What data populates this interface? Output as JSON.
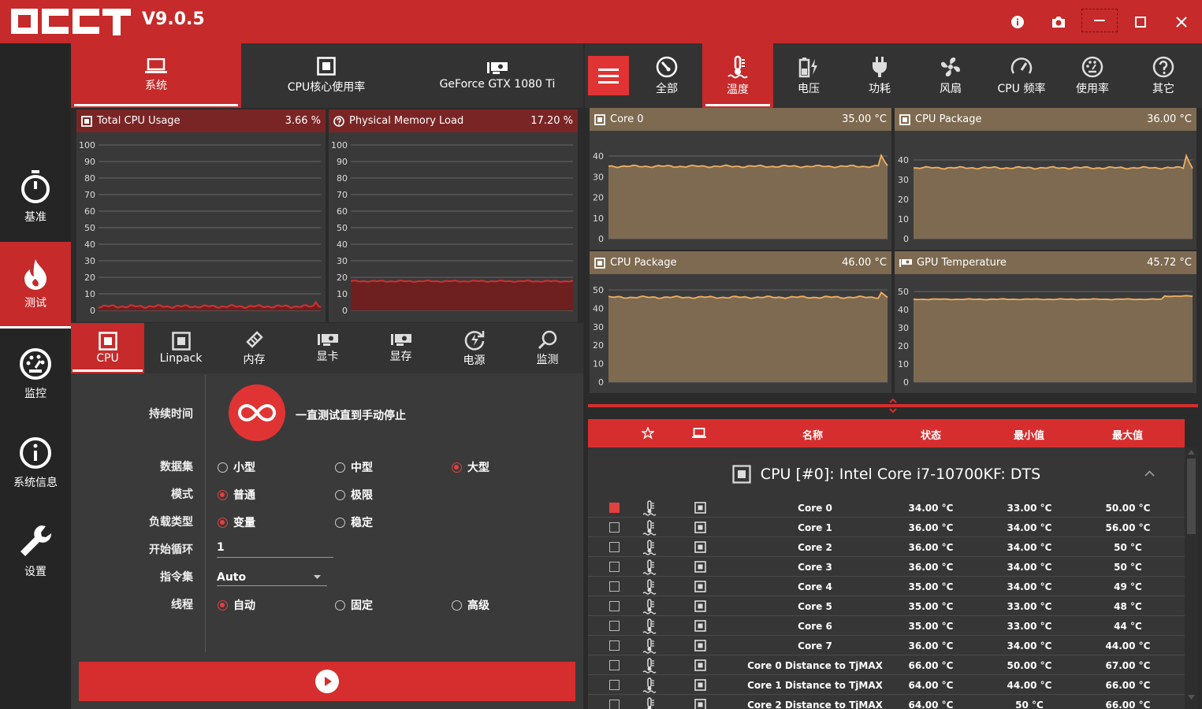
{
  "app": {
    "version": "V9.0.5",
    "accent": "#c62a2a"
  },
  "titlebar": {
    "icons": [
      "info-icon",
      "camera-icon",
      "minimize-icon",
      "maximize-icon",
      "close-icon"
    ]
  },
  "sidebar": {
    "items": [
      {
        "label": "基准",
        "icon": "stopwatch-icon"
      },
      {
        "label": "测试",
        "icon": "flame-icon"
      },
      {
        "label": "监控",
        "icon": "gauge-icon"
      },
      {
        "label": "系统信息",
        "icon": "info-circle-icon"
      },
      {
        "label": "设置",
        "icon": "wrench-icon"
      }
    ]
  },
  "left_tabs": [
    {
      "label": "系统"
    },
    {
      "label": "CPU核心使用率"
    },
    {
      "label": "GeForce GTX 1080 Ti"
    }
  ],
  "graphs": [
    {
      "title": "Total CPU Usage",
      "value": "3.66 %",
      "ticks": [
        "100",
        "90",
        "80",
        "70",
        "60",
        "50",
        "40",
        "30",
        "20",
        "10",
        "0"
      ]
    },
    {
      "title": "Physical Memory Load",
      "value": "17.20 %",
      "ticks": [
        "100",
        "90",
        "80",
        "70",
        "60",
        "50",
        "40",
        "30",
        "20",
        "10",
        "0"
      ]
    }
  ],
  "test_tabs": [
    {
      "label": "CPU"
    },
    {
      "label": "Linpack"
    },
    {
      "label": "内存"
    },
    {
      "label": "显卡"
    },
    {
      "label": "显存"
    },
    {
      "label": "电源"
    },
    {
      "label": "监测"
    }
  ],
  "settings": {
    "duration_label": "持续时间",
    "duration_text": "一直测试直到手动停止",
    "dataset_label": "数据集",
    "dataset_options": [
      "小型",
      "中型",
      "大型"
    ],
    "mode_label": "模式",
    "mode_options": [
      "普通",
      "极限"
    ],
    "load_label": "负载类型",
    "load_options": [
      "变量",
      "稳定"
    ],
    "cycle_label": "开始循环",
    "cycle_value": "1",
    "instr_label": "指令集",
    "instr_value": "Auto",
    "thread_label": "线程",
    "thread_options": [
      "自动",
      "固定",
      "高级"
    ]
  },
  "right_tabs": [
    {
      "label": "全部"
    },
    {
      "label": "温度"
    },
    {
      "label": "电压"
    },
    {
      "label": "功耗"
    },
    {
      "label": "风扇"
    },
    {
      "label": "CPU 频率"
    },
    {
      "label": "使用率"
    },
    {
      "label": "其它"
    }
  ],
  "temp_panels": [
    {
      "title": "Core 0",
      "value": "35.00 °C",
      "ticks": [
        "40",
        "30",
        "20",
        "10",
        "0"
      ]
    },
    {
      "title": "CPU Package",
      "value": "36.00 °C",
      "ticks": [
        "40",
        "30",
        "20",
        "10",
        "0"
      ]
    },
    {
      "title": "CPU Package",
      "value": "46.00 °C",
      "ticks": [
        "50",
        "40",
        "30",
        "20",
        "10",
        "0"
      ]
    },
    {
      "title": "GPU Temperature",
      "value": "45.72 °C",
      "ticks": [
        "50",
        "40",
        "30",
        "20",
        "10",
        "0"
      ]
    }
  ],
  "table": {
    "headers": [
      "名称",
      "状态",
      "最小值",
      "最大值"
    ],
    "group": "CPU [#0]: Intel Core i7-10700KF: DTS",
    "rows": [
      {
        "name": "Core 0",
        "status": "34.00 °C",
        "min": "33.00 °C",
        "max": "50.00 °C",
        "checked": true
      },
      {
        "name": "Core 1",
        "status": "36.00 °C",
        "min": "34.00 °C",
        "max": "56.00 °C",
        "checked": false
      },
      {
        "name": "Core 2",
        "status": "36.00 °C",
        "min": "34.00 °C",
        "max": "50 °C",
        "checked": false
      },
      {
        "name": "Core 3",
        "status": "36.00 °C",
        "min": "34.00 °C",
        "max": "50 °C",
        "checked": false
      },
      {
        "name": "Core 4",
        "status": "35.00 °C",
        "min": "34.00 °C",
        "max": "49 °C",
        "checked": false
      },
      {
        "name": "Core 5",
        "status": "35.00 °C",
        "min": "33.00 °C",
        "max": "48 °C",
        "checked": false
      },
      {
        "name": "Core 6",
        "status": "35.00 °C",
        "min": "33.00 °C",
        "max": "44 °C",
        "checked": false
      },
      {
        "name": "Core 7",
        "status": "36.00 °C",
        "min": "34.00 °C",
        "max": "44.00 °C",
        "checked": false
      },
      {
        "name": "Core 0 Distance to TjMAX",
        "status": "66.00 °C",
        "min": "50.00 °C",
        "max": "67.00 °C",
        "checked": false
      },
      {
        "name": "Core 1 Distance to TjMAX",
        "status": "64.00 °C",
        "min": "44.00 °C",
        "max": "66.00 °C",
        "checked": false
      },
      {
        "name": "Core 2 Distance to TjMAX",
        "status": "64.00 °C",
        "min": "50 °C",
        "max": "66.00 °C",
        "checked": false
      }
    ]
  }
}
